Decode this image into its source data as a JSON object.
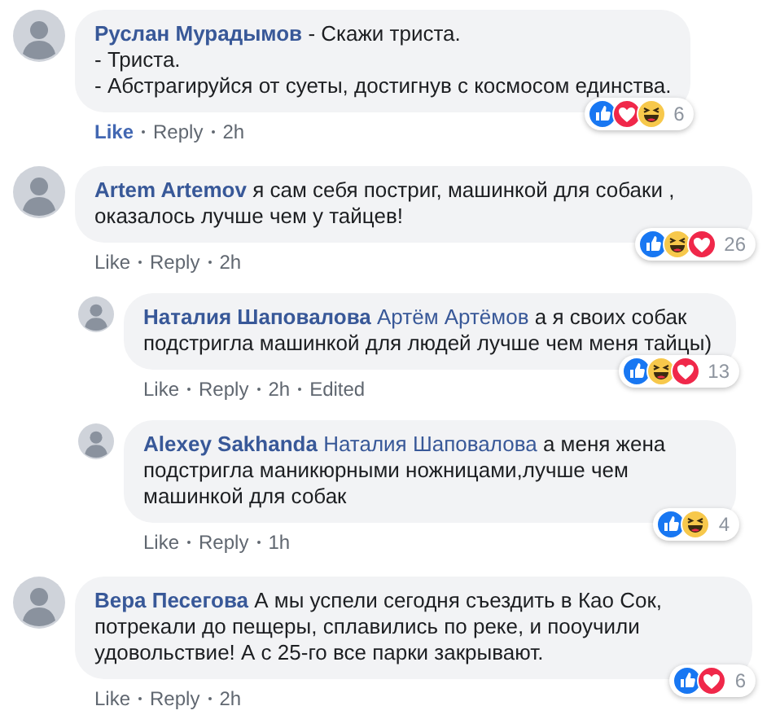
{
  "comments": [
    {
      "author": "Руслан Мурадымов",
      "text": "- Скажи триста.\n- Триста.\n- Абстрагируйся от суеты, достигнув с космосом единства.",
      "reactions": [
        {
          "kind": "like"
        },
        {
          "kind": "love"
        },
        {
          "kind": "haha"
        }
      ],
      "reaction_count": "6",
      "like": "Like",
      "liked": true,
      "reply": "Reply",
      "time": "2h"
    },
    {
      "author": "Artem Artemov",
      "text": "я сам себя постриг, машинкой для собаки , оказалось лучше чем у тайцев!",
      "reactions": [
        {
          "kind": "like"
        },
        {
          "kind": "haha"
        },
        {
          "kind": "love"
        }
      ],
      "reaction_count": "26",
      "like": "Like",
      "liked": false,
      "reply": "Reply",
      "time": "2h",
      "replies": [
        {
          "author": "Наталия Шаповалова",
          "mention": "Артём Артёмов",
          "text": "а я своих собак подстригла машинкой для людей лучше чем меня тайцы)",
          "reactions": [
            {
              "kind": "like"
            },
            {
              "kind": "haha"
            },
            {
              "kind": "love"
            }
          ],
          "reaction_count": "13",
          "like": "Like",
          "liked": false,
          "reply": "Reply",
          "time": "2h",
          "edited": "Edited"
        },
        {
          "author": "Alexey Sakhanda",
          "mention": "Наталия Шаповалова",
          "text": "а меня жена подстригла маникюрными ножницами,лучше чем машинкой для собак",
          "reactions": [
            {
              "kind": "like"
            },
            {
              "kind": "haha"
            }
          ],
          "reaction_count": "4",
          "like": "Like",
          "liked": false,
          "reply": "Reply",
          "time": "1h"
        }
      ]
    },
    {
      "author": "Вера Песегова",
      "text": "А мы успели сегодня съездить в Као Сок, потрекали до пещеры, сплавились по реке, и пооучили удовольствие! А с 25-го все парки закрывают.",
      "reactions": [
        {
          "kind": "like"
        },
        {
          "kind": "love"
        }
      ],
      "reaction_count": "6",
      "like": "Like",
      "liked": false,
      "reply": "Reply",
      "time": "2h"
    }
  ]
}
